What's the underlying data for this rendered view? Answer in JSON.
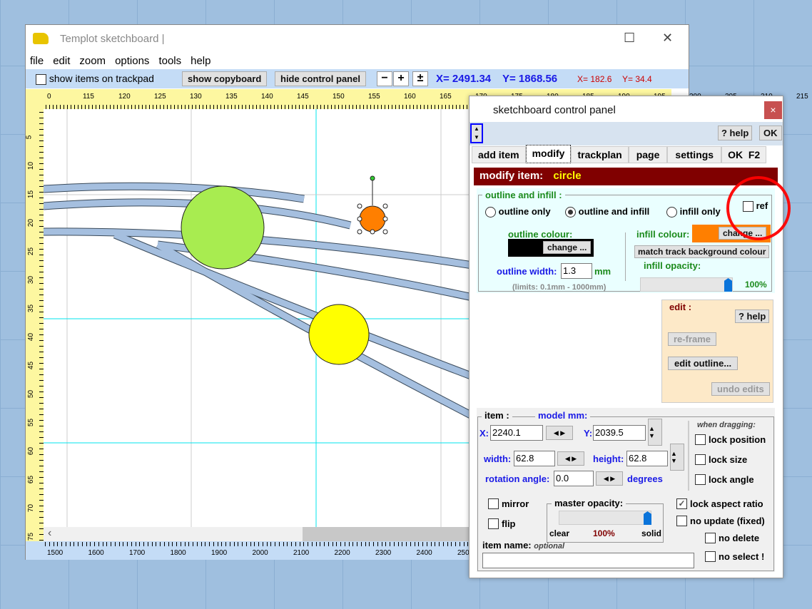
{
  "window": {
    "title": "Templot  sketchboard  |",
    "menu": [
      "file",
      "edit",
      "zoom",
      "options",
      "tools",
      "help"
    ]
  },
  "toolbar": {
    "show_items_label": "show items on trackpad",
    "show_items_checked": false,
    "show_copyboard": "show copyboard",
    "hide_control_panel": "hide control panel",
    "zoom_out": "−",
    "zoom_in": "+",
    "zoom_fit": "±",
    "x_model": "X= 2491.34",
    "y_model": "Y= 1868.56",
    "x_ruler": "X= 182.6",
    "y_ruler": "Y= 34.4"
  },
  "rulers": {
    "top": [
      "0",
      "115",
      "120",
      "125",
      "130",
      "135",
      "140",
      "145",
      "150",
      "155",
      "160",
      "165",
      "170",
      "175",
      "180",
      "185",
      "190",
      "195",
      "200",
      "205",
      "210",
      "215"
    ],
    "left": [
      "5",
      "10",
      "15",
      "20",
      "25",
      "30",
      "35",
      "40",
      "45",
      "50",
      "55",
      "60",
      "65",
      "70",
      "75"
    ],
    "bottom": [
      "1500",
      "1600",
      "1700",
      "1800",
      "1900",
      "2000",
      "2100",
      "2200",
      "2300",
      "2400",
      "250"
    ]
  },
  "canvas": {
    "shapes": [
      {
        "type": "circle",
        "fill": "#a8ec50"
      },
      {
        "type": "circle",
        "fill": "#ffff00"
      },
      {
        "type": "circle",
        "fill": "#ff7f00",
        "selected": true
      }
    ],
    "track_colour": "#a5bfdf"
  },
  "panel": {
    "title": "sketchboard  control  panel",
    "close": "×",
    "help": "? help",
    "ok": "OK",
    "tabs": [
      {
        "label": "add item"
      },
      {
        "label": "modify",
        "active": true
      },
      {
        "label": "trackplan"
      },
      {
        "label": "page"
      },
      {
        "label": "settings"
      },
      {
        "label": "OK  F2"
      }
    ],
    "header_label": "modify item:",
    "header_item": "circle",
    "outline": {
      "group_label": "outline and infill :",
      "options": [
        "outline only",
        "outline and infill",
        "infill only"
      ],
      "selected": 1,
      "ref_label": "ref",
      "ref_checked": false,
      "outline_colour_label": "outline colour:",
      "outline_colour": "#000000",
      "change": "change ...",
      "infill_colour_label": "infill colour:",
      "infill_colour": "#ff7f00",
      "match_bg": "match track background colour",
      "infill_opacity_label": "infill opacity:",
      "infill_opacity": "100%",
      "infill_opacity_value": 100,
      "outline_width_label": "outline width:",
      "outline_width": "1.3",
      "unit": "mm",
      "limits": "(limits: 0.1mm - 1000mm)"
    },
    "edit": {
      "label": "edit :",
      "help": "? help",
      "reframe": "re-frame",
      "edit_outline": "edit outline...",
      "undo": "undo edits"
    },
    "item": {
      "label": "item :",
      "model": "model mm:",
      "x_label": "X:",
      "x": "2240.1",
      "y_label": "Y:",
      "y": "2039.5",
      "width_label": "width:",
      "width": "62.8",
      "height_label": "height:",
      "height": "62.8",
      "rotation_label": "rotation angle:",
      "rotation": "0.0",
      "degrees": "degrees",
      "when_dragging": "when dragging:",
      "lock_position": "lock position",
      "lock_size": "lock size",
      "lock_angle": "lock angle",
      "mirror": "mirror",
      "flip": "flip",
      "master_opacity": "master opacity:",
      "clear": "clear",
      "opacity_value": "100%",
      "opacity_level": 100,
      "solid": "solid",
      "lock_aspect": "lock aspect ratio",
      "lock_aspect_checked": true,
      "no_update": "no update (fixed)",
      "no_delete": "no delete",
      "no_select": "no select !",
      "name_label": "item name:",
      "name_hint": "optional",
      "name": ""
    }
  }
}
